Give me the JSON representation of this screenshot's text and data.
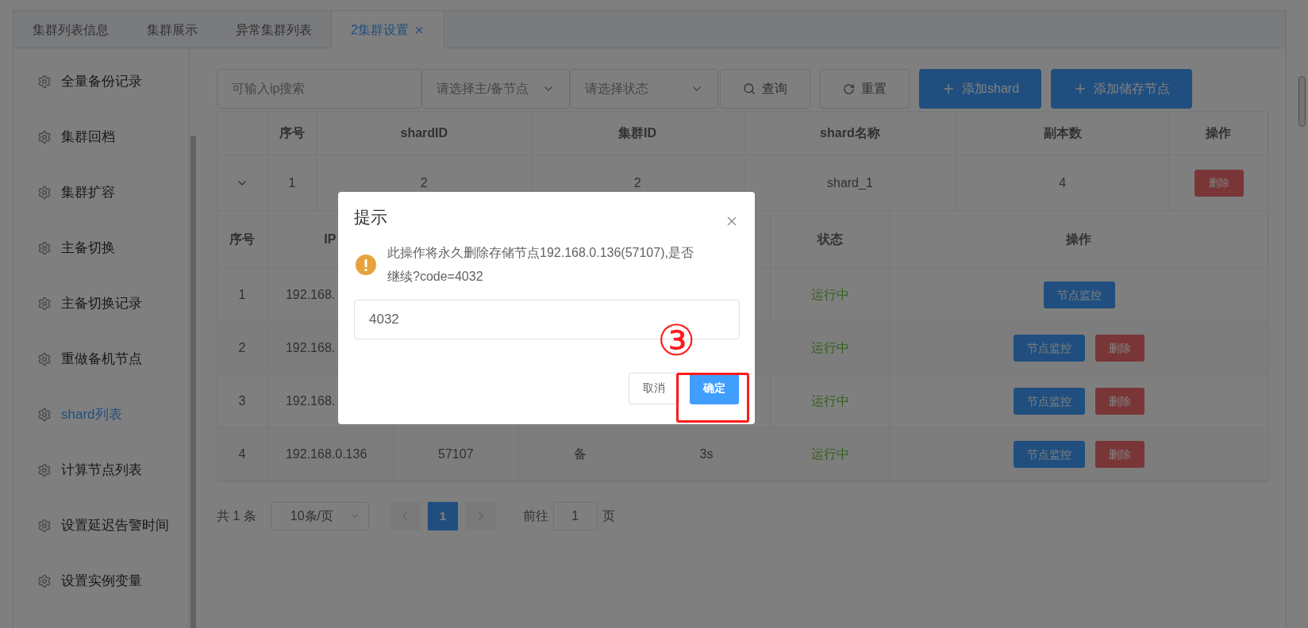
{
  "tabs": [
    {
      "label": "集群列表信息",
      "selected": false,
      "closable": false
    },
    {
      "label": "集群展示",
      "selected": false,
      "closable": false
    },
    {
      "label": "异常集群列表",
      "selected": false,
      "closable": false
    },
    {
      "label": "2集群设置",
      "selected": true,
      "closable": true
    }
  ],
  "sidebar": {
    "items": [
      {
        "label": "全量备份记录",
        "selected": false
      },
      {
        "label": "集群回档",
        "selected": false
      },
      {
        "label": "集群扩容",
        "selected": false
      },
      {
        "label": "主备切换",
        "selected": false
      },
      {
        "label": "主备切换记录",
        "selected": false
      },
      {
        "label": "重做备机节点",
        "selected": false
      },
      {
        "label": "shard列表",
        "selected": true
      },
      {
        "label": "计算节点列表",
        "selected": false
      },
      {
        "label": "设置延迟告警时间",
        "selected": false
      },
      {
        "label": "设置实例变量",
        "selected": false
      }
    ]
  },
  "toolbar": {
    "search": {
      "placeholder": "可输入ip搜索"
    },
    "selects": [
      {
        "placeholder": "请选择主/备节点"
      },
      {
        "placeholder": "请选择状态"
      }
    ],
    "buttons": [
      {
        "label": "查询",
        "kind": "search"
      },
      {
        "label": "重置",
        "kind": "reset"
      },
      {
        "label": "添加shard",
        "kind": "add"
      },
      {
        "label": "添加储存节点",
        "kind": "add"
      }
    ]
  },
  "table": {
    "columns": [
      "序号",
      "shardID",
      "集群ID",
      "shard名称",
      "副本数",
      "操作"
    ],
    "rows": [
      {
        "expanded": true,
        "cells": [
          "1",
          "2",
          "2",
          "shard_1",
          "4"
        ],
        "action": "删除"
      }
    ]
  },
  "sub_table": {
    "columns": [
      {
        "label": "序号"
      },
      {
        "label": "IP"
      },
      {},
      {},
      {},
      {
        "label": "状态"
      },
      {
        "label": "操作"
      }
    ],
    "rows": [
      {
        "cells": [
          "1",
          "192.168.",
          null,
          null,
          null,
          "运行中"
        ],
        "actions": [
          {
            "label": "节点监控",
            "kind": "monitor"
          }
        ]
      },
      {
        "cells": [
          "2",
          "192.168.",
          null,
          null,
          null,
          "运行中"
        ],
        "actions": [
          {
            "label": "节点监控",
            "kind": "monitor"
          },
          {
            "label": "删除",
            "kind": "delete"
          }
        ]
      },
      {
        "cells": [
          "3",
          "192.168.",
          null,
          null,
          null,
          "运行中"
        ],
        "actions": [
          {
            "label": "节点监控",
            "kind": "monitor"
          },
          {
            "label": "删除",
            "kind": "delete"
          }
        ]
      },
      {
        "cells": [
          "4",
          "192.168.0.136",
          "57107",
          "备",
          "3s",
          "运行中"
        ],
        "actions": [
          {
            "label": "节点监控",
            "kind": "monitor"
          },
          {
            "label": "删除",
            "kind": "delete"
          }
        ]
      }
    ]
  },
  "pagination": {
    "total": "共 1 条",
    "page_size": "10条/页",
    "pages": [
      {
        "label": "1",
        "selected": true
      }
    ],
    "goto_label": "前往",
    "goto_value": "1",
    "goto_suffix": "页"
  },
  "dialog": {
    "title": "提示",
    "message": "此操作将永久删除存储节点192.168.0.136(57107),是否继续?code=4032",
    "input_value": "4032",
    "buttons": [
      {
        "label": "取消",
        "kind": "default"
      },
      {
        "label": "确定",
        "kind": "primary"
      }
    ]
  },
  "annotation": {
    "label": "③"
  }
}
